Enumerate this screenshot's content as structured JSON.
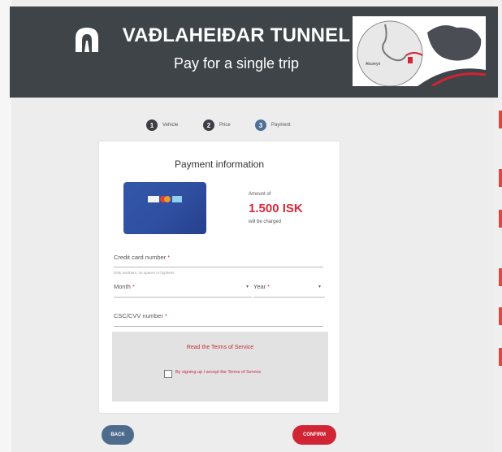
{
  "header": {
    "title": "VAÐLAHEIÐAR TUNNEL",
    "subtitle": "Pay for a single trip",
    "map_label": "Akureyri"
  },
  "steps": [
    {
      "number": "1",
      "label": "Vehicle",
      "active": false
    },
    {
      "number": "2",
      "label": "Price",
      "active": false
    },
    {
      "number": "3",
      "label": "Payment",
      "active": true
    }
  ],
  "payment": {
    "title": "Payment information",
    "amount_prefix": "Amount of",
    "amount": "1.500 ISK",
    "amount_suffix": "will be charged",
    "card_number_label": "Credit card number",
    "card_number_hint": "Only numbers, no spaces or hyphens",
    "month_label": "Month",
    "year_label": "Year",
    "cvc_label": "CSC/CVV number",
    "required_mark": "*",
    "terms_link": "Read the Terms of Service",
    "terms_checkbox": "By signing up I accept the Terms of Service",
    "terms_checked": false
  },
  "buttons": {
    "back": "BACK",
    "confirm": "CONFIRM"
  },
  "colors": {
    "header_bg": "#3f4449",
    "accent_red": "#d12434",
    "step_active": "#4e6f97",
    "back_button": "#4e6b8d"
  }
}
